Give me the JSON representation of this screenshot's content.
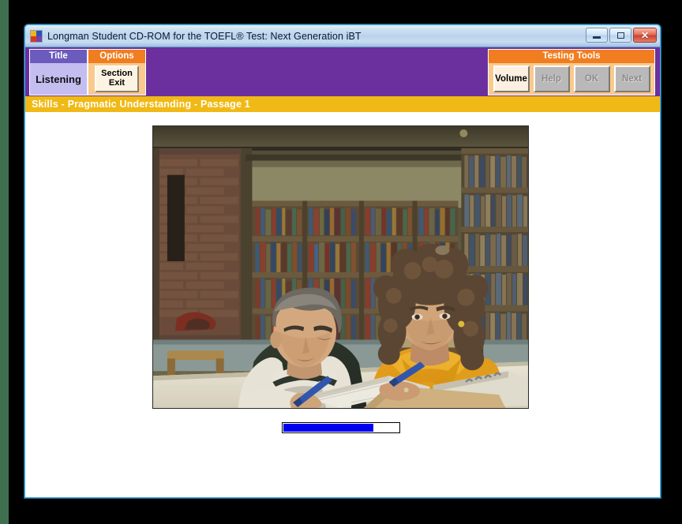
{
  "window": {
    "title": "Longman Student CD-ROM for the TOEFL® Test: Next Generation iBT",
    "app_icon": "puzzle-icon",
    "controls": {
      "minimize": "minimize-icon",
      "maximize": "maximize-icon",
      "close": "✕"
    }
  },
  "toolbar": {
    "title_panel": {
      "header": "Title",
      "value": "Listening"
    },
    "options_panel": {
      "header": "Options",
      "button_line1": "Section",
      "button_line2": "Exit"
    },
    "testing_tools": {
      "header": "Testing Tools",
      "buttons": [
        {
          "label": "Volume",
          "enabled": true
        },
        {
          "label": "Help",
          "enabled": false
        },
        {
          "label": "OK",
          "enabled": false
        },
        {
          "label": "Next",
          "enabled": false
        }
      ]
    }
  },
  "skills_bar": {
    "text": "Skills - Pragmatic Understanding - Passage 1"
  },
  "stage": {
    "photo": {
      "alt": "Two students studying together at a table in a library, surrounded by bookshelves",
      "caption": ""
    },
    "progress": {
      "percent": 78,
      "fill_color": "#0000f0",
      "track_color": "#ffffff",
      "border_color": "#000000"
    }
  },
  "colors": {
    "toolbar_purple": "#6b2f9e",
    "accent_orange": "#f07e20",
    "skills_yellow": "#f0b915",
    "title_panel_header": "#6b5bbd",
    "title_panel_body": "#c3bdf0",
    "options_body": "#f9c98d",
    "desktop_green": "#3e7050",
    "desktop_black": "#000000"
  }
}
